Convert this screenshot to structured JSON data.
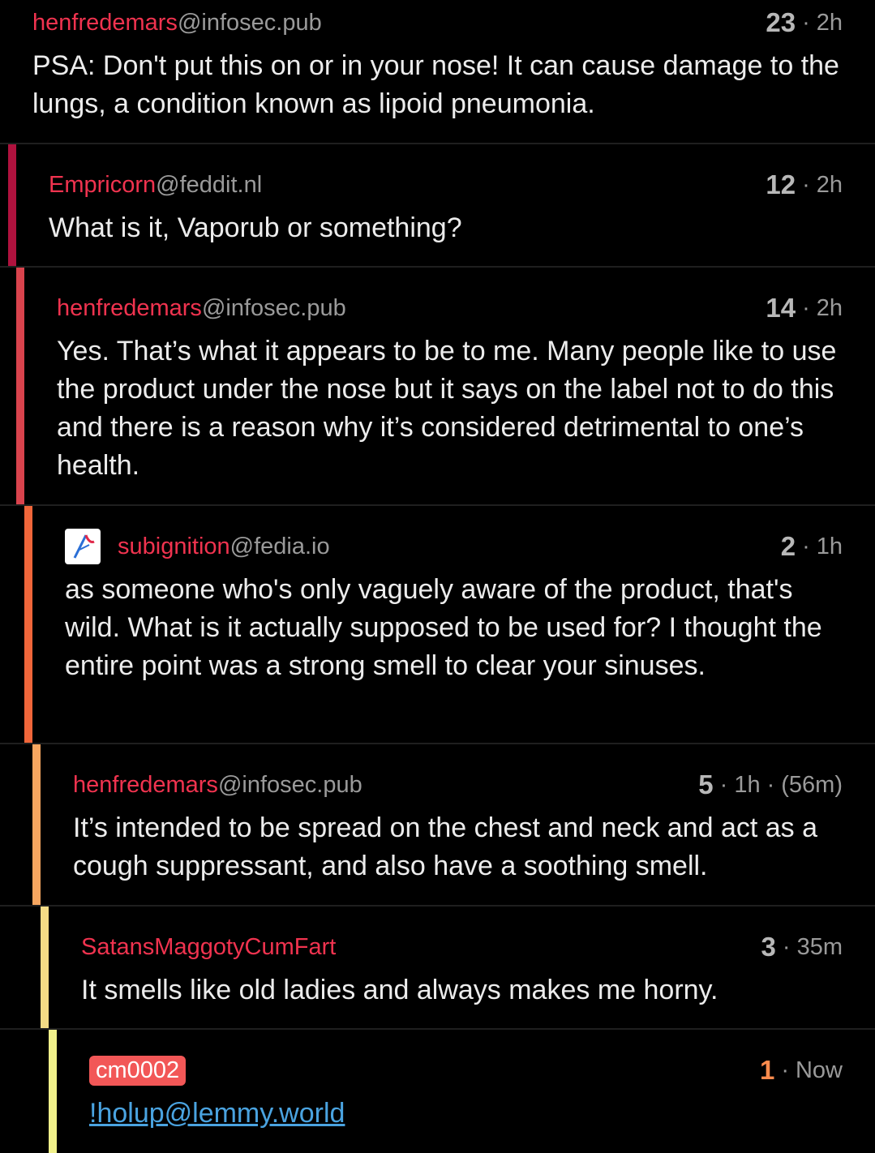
{
  "comments": [
    {
      "user": "henfredemars",
      "instance": "@infosec.pub",
      "score": "23",
      "time": "2h",
      "body": "PSA: Don't put this on or in your nose! It can cause damage to the lungs, a condition known as lipoid pneumonia."
    },
    {
      "user": "Empricorn",
      "instance": "@feddit.nl",
      "score": "12",
      "time": "2h",
      "body": "What is it, Vaporub or something?"
    },
    {
      "user": "henfredemars",
      "instance": "@infosec.pub",
      "score": "14",
      "time": "2h",
      "body": "Yes. That’s what it appears to be to me. Many people like to use the product under the nose but it says on the label not to do this and there is a reason why it’s considered detrimental to one’s health."
    },
    {
      "user": "subignition",
      "instance": "@fedia.io",
      "score": "2",
      "time": "1h",
      "body": "as someone who's only vaguely aware of the product, that's wild. What is it actually supposed to be used for? I thought the entire point was a strong smell to clear your sinuses."
    },
    {
      "user": "henfredemars",
      "instance": "@infosec.pub",
      "score": "5",
      "time": "1h",
      "edited": "(56m)",
      "body": "It’s intended to be spread on the chest and neck and act as a cough suppressant, and also have a soothing smell."
    },
    {
      "user": "SatansMaggotyCumFart",
      "instance": "",
      "score": "3",
      "time": "35m",
      "body": "It smells like old ladies and always makes me horny."
    },
    {
      "user": "cm0002",
      "instance": "",
      "score": "1",
      "time": "Now",
      "body": "!holup@lemmy.world"
    }
  ],
  "colors": {
    "depth1": "#b0123e",
    "depth2": "#d9434d",
    "depth3": "#f0663a",
    "depth4": "#f7a660",
    "depth5": "#f5dc86",
    "depth6": "#f0f08a",
    "username": "#f0334f",
    "own_badge": "#f25757",
    "link": "#4aa3e0"
  },
  "icons": {
    "subignition_avatar": "avatar-icon"
  }
}
